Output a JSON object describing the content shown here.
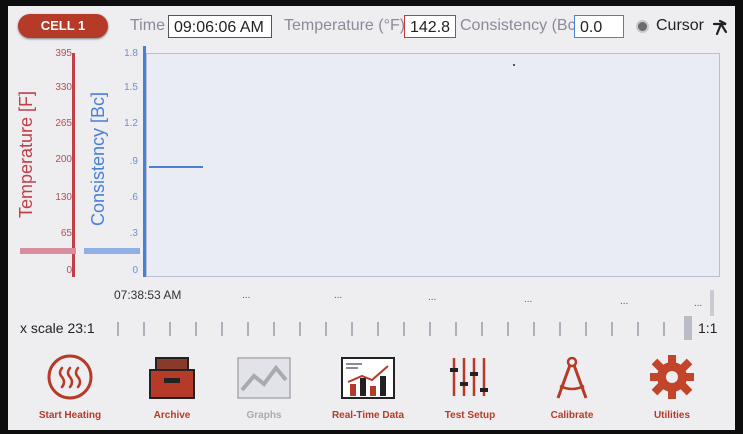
{
  "header": {
    "cell_label": "CELL 1",
    "time_label": "Time",
    "time_value": "09:06:06 AM",
    "temperature_label": "Temperature (°F)",
    "temperature_value": "142.8",
    "consistency_label": "Consistency (Bc)",
    "consistency_value": "0.0",
    "cursor_label": "Cursor"
  },
  "graph": {
    "temp_axis_label": "Temperature [F]",
    "consistency_axis_label": "Consistency [Bc]",
    "temp_ticks": [
      "395",
      "330",
      "265",
      "200",
      "130",
      "65",
      "0"
    ],
    "consistency_ticks": [
      "1.8",
      "1.5",
      "1.2",
      ".9",
      ".6",
      ".3",
      "0"
    ],
    "start_time": "07:38:53 AM",
    "x_markers": [
      "...",
      "...",
      "...",
      "...",
      "...",
      "...",
      "..."
    ]
  },
  "scale": {
    "label": "x scale 23:1",
    "ratio": "1:1"
  },
  "nav": [
    {
      "label": "Start Heating",
      "icon": "heat-icon"
    },
    {
      "label": "Archive",
      "icon": "archive-box-icon"
    },
    {
      "label": "Graphs",
      "icon": "graph-icon"
    },
    {
      "label": "Real-Time Data",
      "icon": "realtime-chart-icon"
    },
    {
      "label": "Test Setup",
      "icon": "sliders-icon"
    },
    {
      "label": "Calibrate",
      "icon": "compass-icon"
    },
    {
      "label": "Utilities",
      "icon": "gear-icon"
    }
  ],
  "colors": {
    "accent": "#b53a27",
    "temperature": "#c0404a",
    "consistency": "#4a7fd8",
    "disabled": "#a9a9b0"
  }
}
